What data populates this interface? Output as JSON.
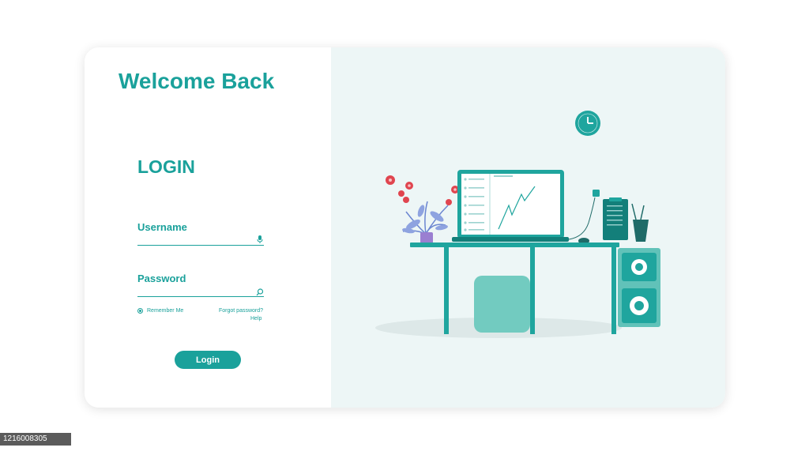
{
  "login_panel": {
    "welcome_title": "Welcome Back",
    "login_heading": "LOGIN",
    "username_label": "Username",
    "password_label": "Password",
    "remember_label": "Remember Me",
    "forgot_link": "Forgot password?",
    "help_link": "Help",
    "login_button": "Login"
  },
  "stock_id": "1216008305",
  "icons": {
    "username_field": "microphone-icon",
    "password_field": "search-icon"
  },
  "colors": {
    "accent": "#1aa19b",
    "illustration_panel_bg": "#edf6f6",
    "flower": "#e0454f",
    "pot": "#9a7fd1"
  }
}
